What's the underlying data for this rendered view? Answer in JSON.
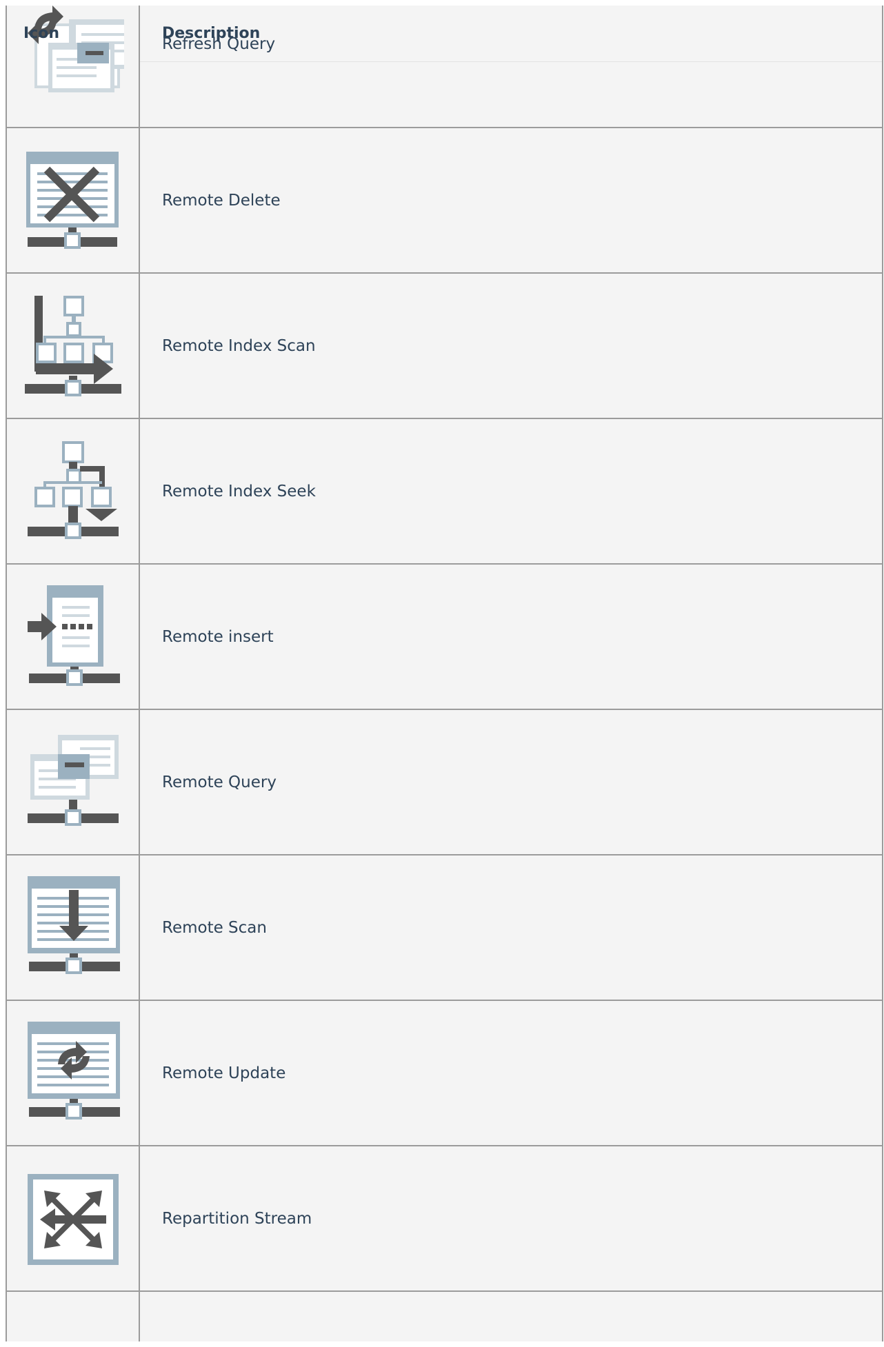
{
  "table": {
    "headers": {
      "icon": "Icon",
      "description": "Description"
    },
    "rows": [
      {
        "label": "Refresh Query",
        "icon": "refresh-query-icon"
      },
      {
        "label": "Remote Delete",
        "icon": "remote-delete-icon"
      },
      {
        "label": "Remote Index Scan",
        "icon": "remote-index-scan-icon"
      },
      {
        "label": "Remote Index Seek",
        "icon": "remote-index-seek-icon"
      },
      {
        "label": "Remote insert",
        "icon": "remote-insert-icon"
      },
      {
        "label": "Remote Query",
        "icon": "remote-query-icon"
      },
      {
        "label": "Remote Scan",
        "icon": "remote-scan-icon"
      },
      {
        "label": "Remote Update",
        "icon": "remote-update-icon"
      },
      {
        "label": "Repartition Stream",
        "icon": "repartition-stream-icon"
      },
      {
        "label": "",
        "icon": ""
      }
    ]
  },
  "colors": {
    "text": "#2e4358",
    "row_bg": "#f4f4f4",
    "border": "#9b9b9b",
    "icon_dark": "#555555",
    "icon_light": "#9bb1c0",
    "icon_pale": "#cfd9df"
  }
}
